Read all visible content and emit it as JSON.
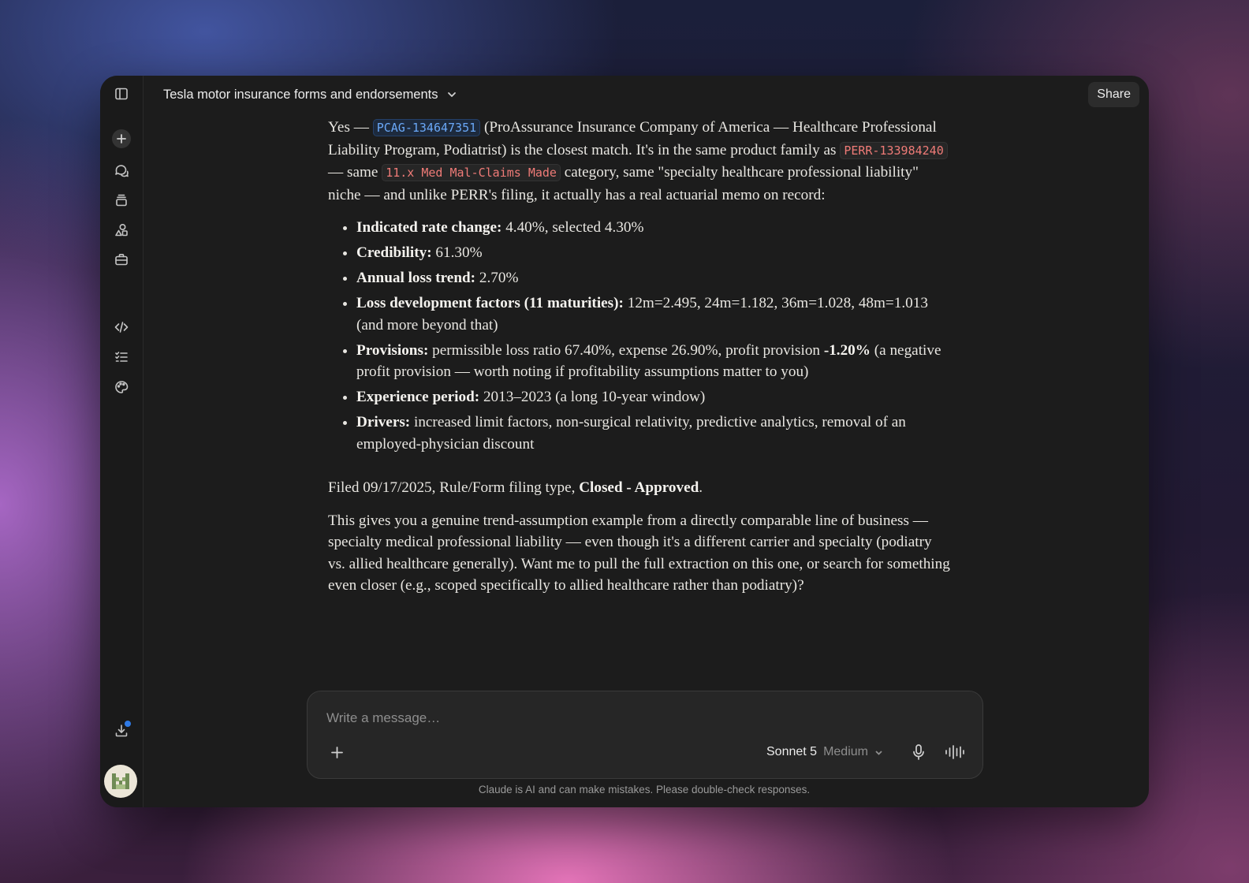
{
  "header": {
    "title": "Tesla motor insurance forms and endorsements",
    "share_label": "Share"
  },
  "sidebar": {
    "items": [
      {
        "name": "toggle-sidebar",
        "icon": "sidebar-panel-icon"
      },
      {
        "name": "new-chat",
        "icon": "plus-icon"
      },
      {
        "name": "chats",
        "icon": "chat-bubbles-icon"
      },
      {
        "name": "projects",
        "icon": "layers-icon"
      },
      {
        "name": "artifacts",
        "icon": "shapes-icon"
      },
      {
        "name": "tools",
        "icon": "briefcase-icon"
      },
      {
        "name": "code",
        "icon": "code-icon"
      },
      {
        "name": "tasks",
        "icon": "checklist-icon"
      },
      {
        "name": "design",
        "icon": "palette-icon"
      },
      {
        "name": "download",
        "icon": "download-icon"
      }
    ]
  },
  "message": {
    "intro_1": "Yes — ",
    "code_1": "PCAG-134647351",
    "intro_2": " (ProAssurance Insurance Company of America — Healthcare Professional Liability Program, Podiatrist) is the closest match. It's in the same product family as ",
    "code_2": "PERR-133984240",
    "intro_3": " — same ",
    "code_3": "11.x Med Mal-Claims Made",
    "intro_4": " category, same \"specialty healthcare professional liability\" niche — and unlike PERR's filing, it actually has a real actuarial memo on record:",
    "bullets": [
      {
        "label": "Indicated rate change:",
        "text": " 4.40%, selected 4.30%"
      },
      {
        "label": "Credibility:",
        "text": " 61.30%"
      },
      {
        "label": "Annual loss trend:",
        "text": " 2.70%"
      },
      {
        "label": "Loss development factors (11 maturities):",
        "text": " 12m=2.495, 24m=1.182, 36m=1.028, 48m=1.013 (and more beyond that)"
      },
      {
        "label": "Provisions:",
        "text": " permissible loss ratio 67.40%, expense 26.90%, profit provision ",
        "bold_2": "-1.20%",
        "text_2": " (a negative profit provision — worth noting if profitability assumptions matter to you)"
      },
      {
        "label": "Experience period:",
        "text": " 2013–2023 (a long 10-year window)"
      },
      {
        "label": "Drivers:",
        "text": " increased limit factors, non-surgical relativity, predictive analytics, removal of an employed-physician discount"
      }
    ],
    "filed_text": "Filed 09/17/2025, Rule/Form filing type, ",
    "filed_status": "Closed - Approved",
    "filed_end": ".",
    "closing": "This gives you a genuine trend-assumption example from a directly comparable line of business — specialty medical professional liability — even though it's a different carrier and specialty (podiatry vs. allied healthcare generally). Want me to pull the full extraction on this one, or search for something even closer (e.g., scoped specifically to allied healthcare rather than podiatry)?"
  },
  "composer": {
    "placeholder": "Write a message…",
    "model": "Sonnet 5",
    "effort": "Medium"
  },
  "footer": {
    "disclaimer": "Claude is AI and can make mistakes. Please double-check responses."
  },
  "colors": {
    "accent_blue": "#2f7ae5",
    "code_blue": "#6aa8f7",
    "code_red": "#ef7b77"
  }
}
